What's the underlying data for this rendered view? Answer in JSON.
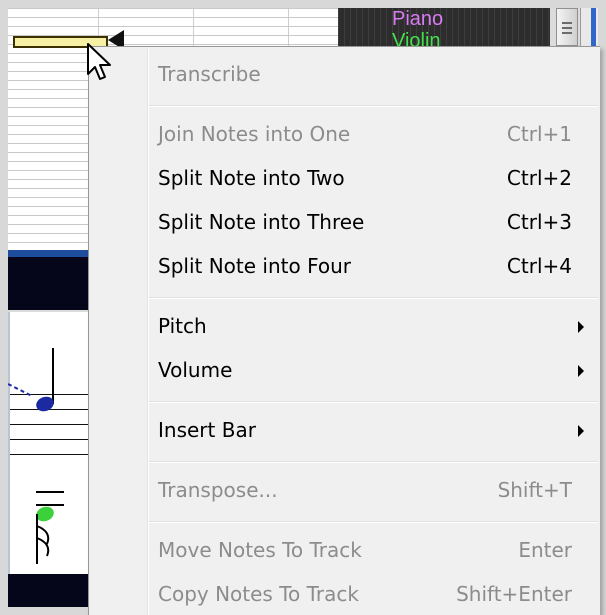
{
  "tracks": {
    "names": [
      "Piano",
      "Violin"
    ]
  },
  "colors": {
    "piano_track": "#d97bf2",
    "violin_track": "#46e14a",
    "selected_note": "#f7f0a4",
    "menu_background": "#f0f0f0",
    "disabled_text": "#8c8c8c"
  },
  "context_menu": {
    "title": "Transcribe",
    "items": [
      {
        "label": "Join Notes into One",
        "shortcut": "Ctrl+1",
        "enabled": false
      },
      {
        "label": "Split Note into Two",
        "shortcut": "Ctrl+2",
        "enabled": true
      },
      {
        "label": "Split Note into Three",
        "shortcut": "Ctrl+3",
        "enabled": true
      },
      {
        "label": "Split Note into Four",
        "shortcut": "Ctrl+4",
        "enabled": true
      },
      {
        "label": "Pitch",
        "shortcut": "",
        "enabled": true,
        "submenu": true
      },
      {
        "label": "Volume",
        "shortcut": "",
        "enabled": true,
        "submenu": true
      },
      {
        "label": "Insert Bar",
        "shortcut": "",
        "enabled": true,
        "submenu": true
      },
      {
        "label": "Transpose...",
        "shortcut": "Shift+T",
        "enabled": false
      },
      {
        "label": "Move Notes To Track",
        "shortcut": "Enter",
        "enabled": false
      },
      {
        "label": "Copy Notes To Track",
        "shortcut": "Shift+Enter",
        "enabled": false
      }
    ]
  },
  "icons": {
    "cursor": "mouse-pointer-icon",
    "submenu": "submenu-arrow-icon",
    "note_marker": "left-pointing-triangle-icon"
  }
}
